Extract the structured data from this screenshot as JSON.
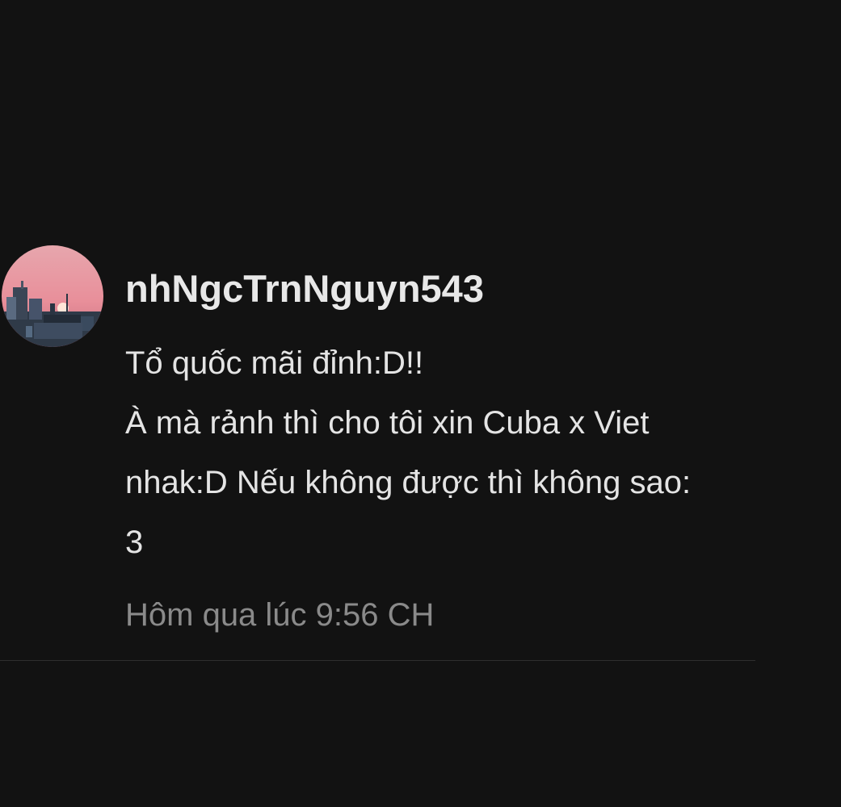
{
  "comment": {
    "avatar_icon": "sunset-avatar-icon",
    "username": "nhNgcTrnNguyn543",
    "body_lines": [
      "Tổ quốc mãi đỉnh:D!!",
      "À mà rảnh thì cho tôi xin Cuba x Viet",
      "nhak:D Nếu không được thì không sao:",
      "3"
    ],
    "timestamp": "Hôm qua lúc 9:56 CH"
  },
  "colors": {
    "background": "#121212",
    "username": "#e8e8e8",
    "body": "#e4e4e4",
    "timestamp": "#8a8a8a",
    "divider": "#2e2e2e"
  }
}
